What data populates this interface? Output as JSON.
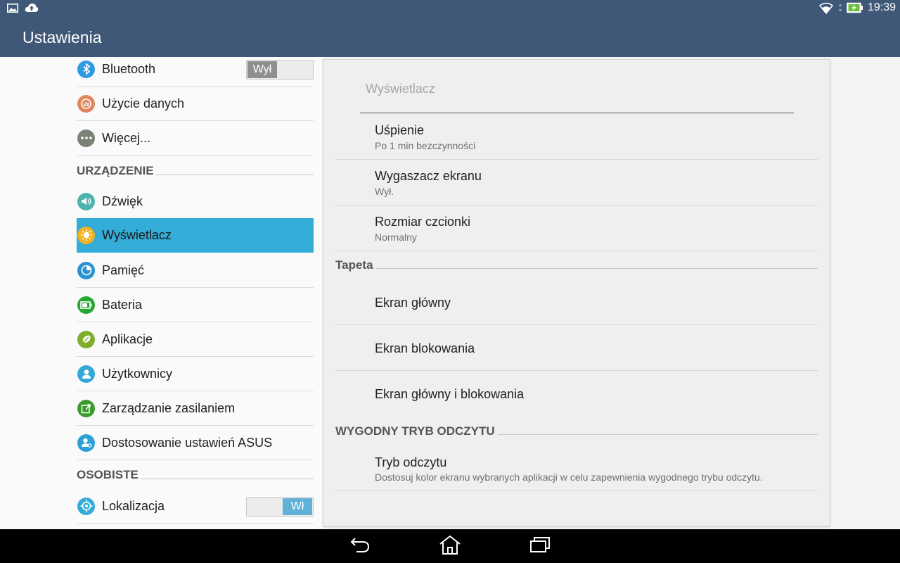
{
  "status_bar": {
    "time": "19:39",
    "icons": [
      "image-icon",
      "cloud-upload-icon",
      "wifi-icon",
      "battery-charging-icon"
    ]
  },
  "action_bar": {
    "title": "Ustawienia"
  },
  "sidebar": {
    "bluetooth": {
      "label": "Bluetooth",
      "toggle": "Wył",
      "state": "off"
    },
    "data_usage": {
      "label": "Użycie danych"
    },
    "more": {
      "label": "Więcej..."
    },
    "section_device": "URZĄDZENIE",
    "sound": {
      "label": "Dźwięk"
    },
    "display": {
      "label": "Wyświetlacz",
      "selected": true
    },
    "storage": {
      "label": "Pamięć"
    },
    "battery": {
      "label": "Bateria"
    },
    "apps": {
      "label": "Aplikacje"
    },
    "users": {
      "label": "Użytkownicy"
    },
    "power": {
      "label": "Zarządzanie zasilaniem"
    },
    "asus": {
      "label": "Dostosowanie ustawień ASUS"
    },
    "section_personal": "OSOBISTE",
    "location": {
      "label": "Lokalizacja",
      "toggle": "Wł",
      "state": "on"
    }
  },
  "detail": {
    "title": "Wyświetlacz",
    "items": [
      {
        "title": "Uśpienie",
        "summary": "Po 1 min bezczynności"
      },
      {
        "title": "Wygaszacz ekranu",
        "summary": "Wył."
      },
      {
        "title": "Rozmiar czcionki",
        "summary": "Normalny"
      }
    ],
    "section_wallpaper": "Tapeta",
    "wallpaper_items": [
      {
        "title": "Ekran główny"
      },
      {
        "title": "Ekran blokowania"
      },
      {
        "title": "Ekran główny i blokowania"
      }
    ],
    "section_reading": "WYGODNY TRYB ODCZYTU",
    "reading": {
      "title": "Tryb odczytu",
      "summary": "Dostosuj kolor ekranu wybranych aplikacji w celu zapewnienia wygodnego trybu odczytu."
    }
  },
  "colors": {
    "bar": "#3f5877",
    "selected": "#33acd8"
  }
}
